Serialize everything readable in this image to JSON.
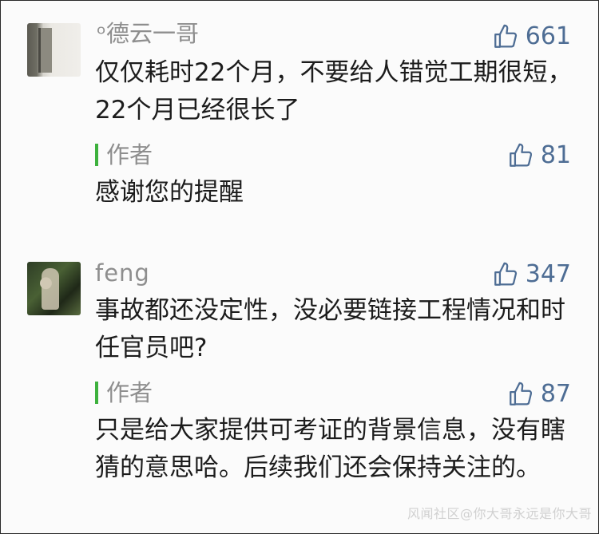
{
  "comments": [
    {
      "username": "ᵒ德云一哥",
      "likes": "661",
      "text": "仅仅耗时22个月，不要给人错觉工期很短，22个月已经很长了",
      "reply": {
        "author": "作者",
        "likes": "81",
        "text": "感谢您的提醒"
      }
    },
    {
      "username": "feng",
      "likes": "347",
      "text": "事故都还没定性，没必要链接工程情况和时任官员吧?",
      "reply": {
        "author": "作者",
        "likes": "87",
        "text": "只是给大家提供可考证的背景信息，没有瞎猜的意思哈。后续我们还会保持关注的。"
      }
    }
  ],
  "watermark": "风闻社区@你大哥永远是你大哥",
  "icons": {
    "like": "thumbs-up-icon"
  },
  "colors": {
    "like": "#4e6d94",
    "author_bar": "#3db13d",
    "meta_text": "#8e8e8e"
  }
}
